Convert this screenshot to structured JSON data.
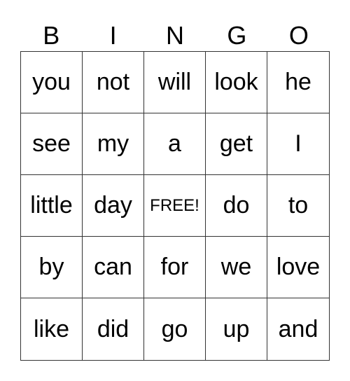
{
  "header": [
    "B",
    "I",
    "N",
    "G",
    "O"
  ],
  "cells": [
    "you",
    "not",
    "will",
    "look",
    "he",
    "see",
    "my",
    "a",
    "get",
    "I",
    "little",
    "day",
    "FREE!",
    "do",
    "to",
    "by",
    "can",
    "for",
    "we",
    "love",
    "like",
    "did",
    "go",
    "up",
    "and"
  ]
}
